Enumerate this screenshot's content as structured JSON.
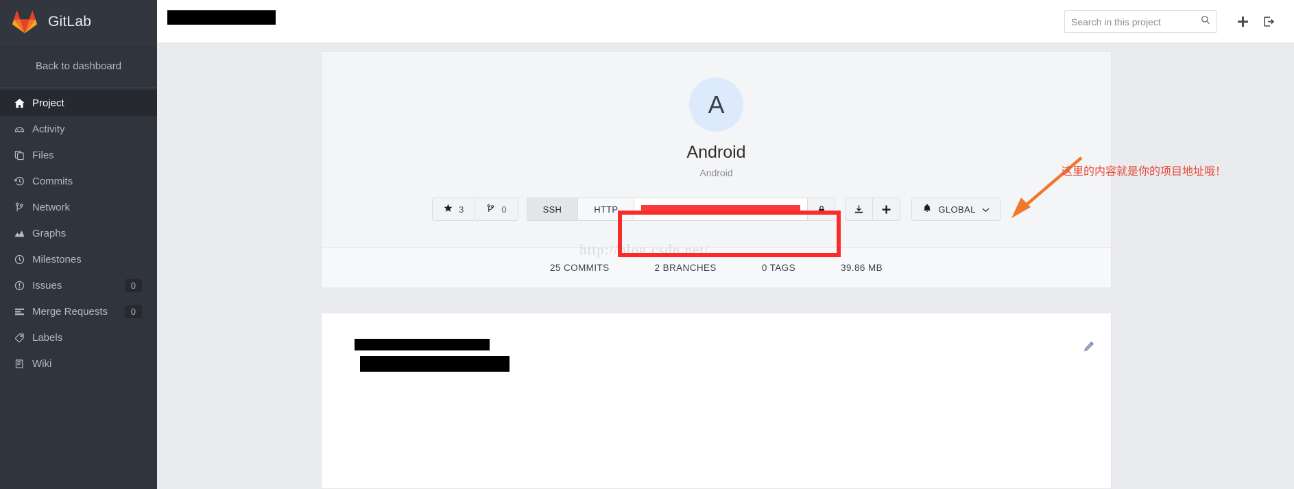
{
  "brand": {
    "name": "GitLab",
    "logo_icon": "gitlab-tanuki-logo"
  },
  "sidebar": {
    "back_label": "Back to dashboard",
    "items": [
      {
        "label": "Project",
        "icon": "home-icon",
        "badge": null,
        "active": true
      },
      {
        "label": "Activity",
        "icon": "dashboard-icon",
        "badge": null,
        "active": false
      },
      {
        "label": "Files",
        "icon": "files-icon",
        "badge": null,
        "active": false
      },
      {
        "label": "Commits",
        "icon": "history-icon",
        "badge": null,
        "active": false
      },
      {
        "label": "Network",
        "icon": "branch-icon",
        "badge": null,
        "active": false
      },
      {
        "label": "Graphs",
        "icon": "area-chart-icon",
        "badge": null,
        "active": false
      },
      {
        "label": "Milestones",
        "icon": "clock-icon",
        "badge": null,
        "active": false
      },
      {
        "label": "Issues",
        "icon": "exclamation-circle-icon",
        "badge": "0",
        "active": false
      },
      {
        "label": "Merge Requests",
        "icon": "merge-request-icon",
        "badge": "0",
        "active": false
      },
      {
        "label": "Labels",
        "icon": "tag-icon",
        "badge": null,
        "active": false
      },
      {
        "label": "Wiki",
        "icon": "book-icon",
        "badge": null,
        "active": false
      }
    ]
  },
  "topbar": {
    "project_name_redacted": true,
    "search_placeholder": "Search in this project",
    "search_value": "",
    "search_icon": "search-icon",
    "new_icon": "plus-icon",
    "signout_icon": "sign-out-icon"
  },
  "project": {
    "avatar_letter": "A",
    "title": "Android",
    "subtitle": "Android",
    "star_icon": "star-icon",
    "star_count": "3",
    "fork_icon": "fork-icon",
    "fork_count": "0",
    "protocol_ssh": "SSH",
    "protocol_http": "HTTP",
    "active_protocol": "SSH",
    "clone_url_redacted": true,
    "copy_icon": "clipboard-lock-icon",
    "download_icon": "download-icon",
    "add_icon": "plus-icon",
    "notification_icon": "bell-icon",
    "notification_label": "GLOBAL",
    "notification_caret_icon": "chevron-down-icon"
  },
  "stats": [
    {
      "label": "25 COMMITS"
    },
    {
      "label": "2 BRANCHES"
    },
    {
      "label": "0 TAGS"
    },
    {
      "label": "39.86 MB"
    }
  ],
  "readme": {
    "line1_redacted": true,
    "line2_redacted": true,
    "edit_icon": "pencil-icon"
  },
  "annotation": {
    "text": "这里的内容就是你的项目地址哦！",
    "color": "#e84a3a",
    "arrow_icon": "arrow-pointer-icon",
    "arrow_color": "#f0782c",
    "highlight_color": "#f92c2c"
  },
  "watermark": {
    "text": "http://blog.csdn.net/"
  }
}
